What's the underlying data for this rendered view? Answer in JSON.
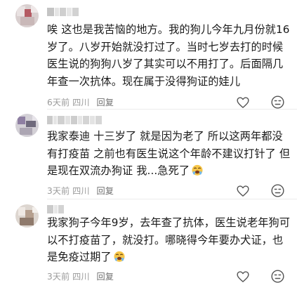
{
  "comments": [
    {
      "text": "唉 这也是我苦恼的地方。我的狗儿今年九月份就16岁了。八岁开始就没打过了。当时七岁去打的时候医生说的狗狗八岁了其实可以不用打了。后面隔几年查一次抗体。现在属于没得狗证的娃儿",
      "time": "6天前",
      "location": "四川",
      "reply_label": "回复",
      "has_emoji": false
    },
    {
      "text": "我家泰迪 十三岁了 就是因为老了 所以这两年都没有打疫苗 之前也有医生说这个年龄不建议打针了 但是现在双流办狗证 我...急死了",
      "time": "3天前",
      "location": "四川",
      "reply_label": "回复",
      "has_emoji": true
    },
    {
      "text": "我家狗子今年9岁，去年查了抗体，医生说老年狗可以不打疫苗了，就没打。哪晓得今年要办犬证，也是免疫过期了",
      "time": "3天前",
      "location": "四川",
      "reply_label": "回复",
      "has_emoji": true
    }
  ],
  "icons": {
    "like": "heart-outline-icon",
    "dislike": "dislike-face-icon",
    "emoji": "crying-face-emoji"
  },
  "colors": {
    "text": "#1a1a1a",
    "meta": "#9b9b9b",
    "icon": "#555555"
  }
}
